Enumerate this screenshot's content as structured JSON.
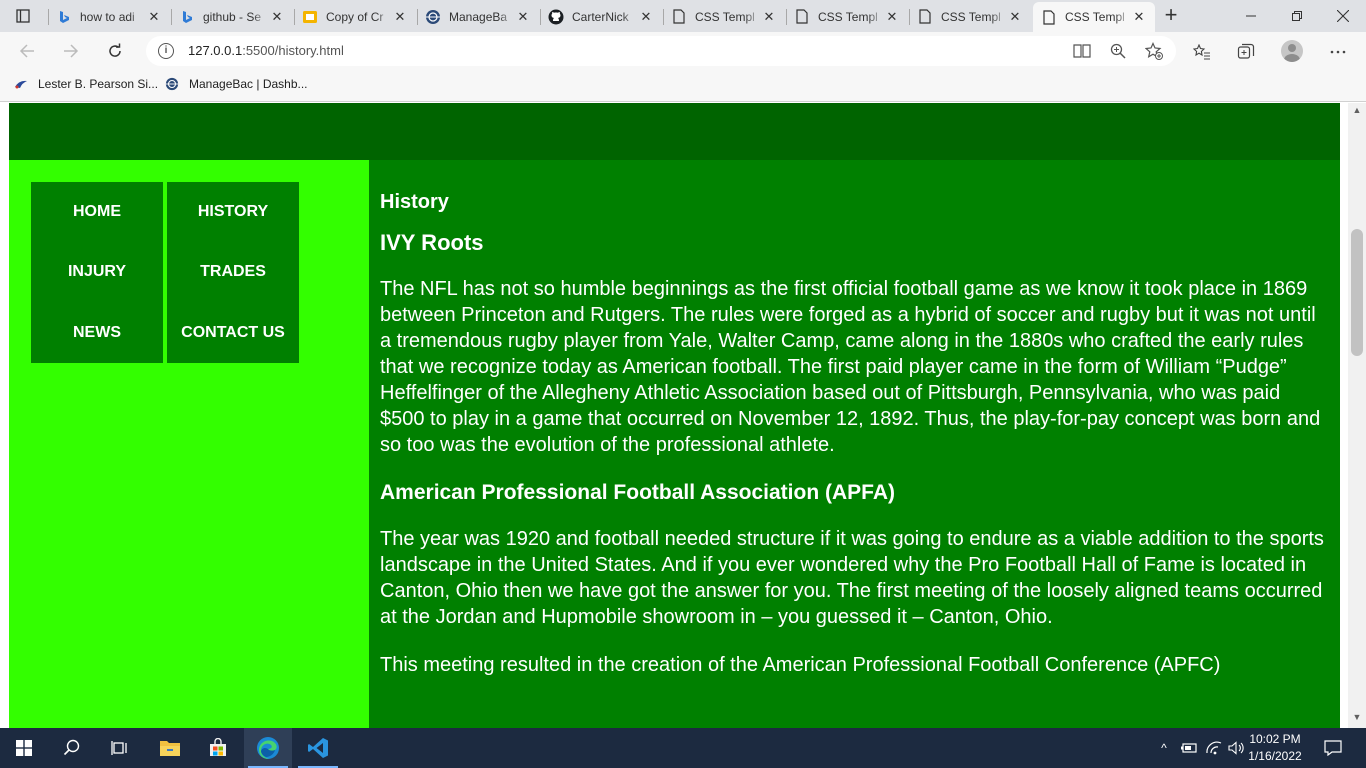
{
  "browser": {
    "tabs": [
      {
        "title": "how to adi",
        "icon": "bing-icon",
        "close": "✕"
      },
      {
        "title": "github - Se",
        "icon": "bing-icon",
        "close": "✕"
      },
      {
        "title": "Copy of Cr",
        "icon": "slides-icon",
        "close": "✕"
      },
      {
        "title": "ManageBa",
        "icon": "managebac-icon",
        "close": "✕"
      },
      {
        "title": "CarterNick",
        "icon": "github-icon",
        "close": "✕"
      },
      {
        "title": "CSS Templ",
        "icon": "page-icon",
        "close": "✕"
      },
      {
        "title": "CSS Templ",
        "icon": "page-icon",
        "close": "✕"
      },
      {
        "title": "CSS Templ",
        "icon": "page-icon",
        "close": "✕"
      },
      {
        "title": "CSS Templ",
        "icon": "page-icon",
        "close": "✕",
        "active": true
      }
    ],
    "new_tab": "+",
    "window_controls": {
      "minimize": "—",
      "restore": "❐",
      "close": "✕"
    },
    "address": {
      "host": "127.0.0.1",
      "path": ":5500/history.html"
    },
    "favorites": [
      {
        "label": "Lester B. Pearson Si...",
        "icon": "school-icon"
      },
      {
        "label": "ManageBac | Dashb...",
        "icon": "managebac-icon"
      }
    ]
  },
  "page": {
    "colors": {
      "header": "#006400",
      "sidebar": "#33ff00",
      "content": "#008000",
      "nav": "#008000"
    },
    "nav": {
      "left": [
        "HOME",
        "INJURY",
        "NEWS"
      ],
      "right": [
        "HISTORY",
        "TRADES",
        "CONTACT US"
      ]
    },
    "content": {
      "title": "History",
      "section1_heading": "IVY Roots",
      "section1_text": "The NFL has not so humble beginnings as the first official football game as we know it took place in 1869 between Princeton and Rutgers. The rules were forged as a hybrid of soccer and rugby but it was not until a tremendous rugby player from Yale, Walter Camp, came along in the 1880s who crafted the early rules that we recognize today as American football. The first paid player came in the form of William “Pudge” Heffelfinger of the Allegheny Athletic Association based out of Pittsburgh, Pennsylvania, who was paid $500 to play in a game that occurred on November 12, 1892. Thus, the play-for-pay concept was born and so too was the evolution of the professional athlete.",
      "section2_heading": "American Professional Football Association (APFA)",
      "section2_text": "The year was 1920 and football needed structure if it was going to endure as a viable addition to the sports landscape in the United States. And if you ever wondered why the Pro Football Hall of Fame is located in Canton, Ohio then we have got the answer for you. The first meeting of the loosely aligned teams occurred at the Jordan and Hupmobile showroom in – you guessed it – Canton, Ohio.",
      "section3_text": "This meeting resulted in the creation of the American Professional Football Conference (APFC)"
    }
  },
  "taskbar": {
    "time": "10:02 PM",
    "date": "1/16/2022",
    "tray_caret": "^"
  }
}
